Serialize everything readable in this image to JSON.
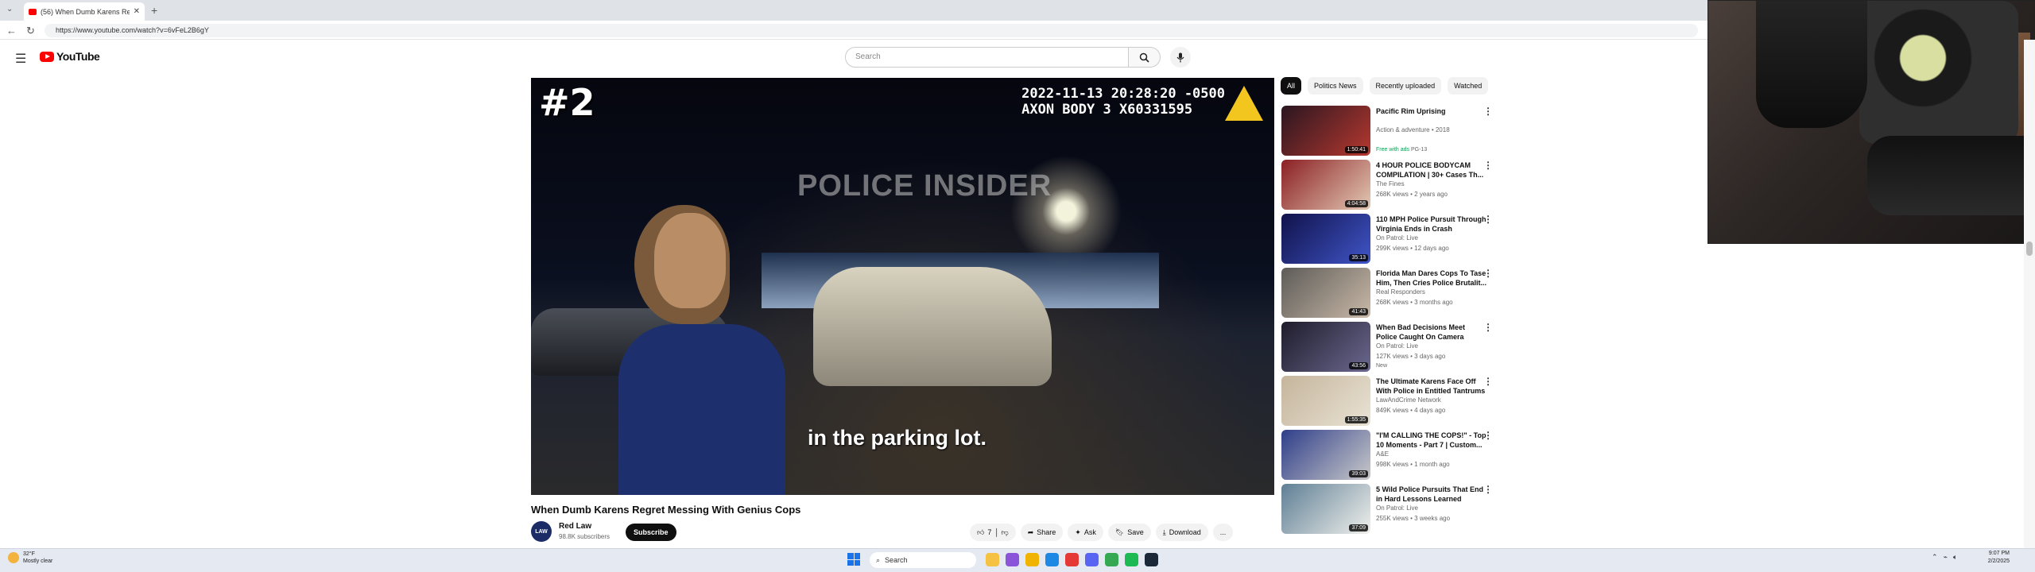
{
  "browser": {
    "tab_title": "(56) When Dumb Karens Re",
    "new_tab": "+",
    "url": "https://www.youtube.com/watch?v=6vFeL2B6gY"
  },
  "youtube": {
    "logo": "YouTube",
    "search_placeholder": "Search"
  },
  "video": {
    "rank_overlay": "#2",
    "timestamp_line1": "2022-11-13 20:28:20 -0500",
    "timestamp_line2": "AXON BODY 3 X60331595",
    "watermark": "POLICE INSIDER",
    "caption": "in the parking lot.",
    "title": "When Dumb Karens Regret Messing With Genius Cops",
    "channel_name": "Red Law",
    "channel_avatar_text": "LAW",
    "channel_subs": "98.8K subscribers",
    "subscribe_label": "Subscribe",
    "like_count": "7",
    "share_label": "Share",
    "ask_label": "Ask",
    "save_label": "Save",
    "download_label": "Download",
    "more_label": "..."
  },
  "chips": [
    "All",
    "Politics News",
    "Recently uploaded",
    "Watched"
  ],
  "recommendations": [
    {
      "title": "Pacific Rim Uprising",
      "channel": "Action & adventure • 2018",
      "meta": "",
      "badge_free": "Free with ads",
      "badge_rating": "PG-13",
      "duration": "1:50:41",
      "colors": [
        "#2a1620",
        "#b6382f"
      ]
    },
    {
      "title": "4 HOUR POLICE BODYCAM COMPILATION | 30+ Cases Th...",
      "channel": "The Fines",
      "meta": "268K views • 2 years ago",
      "badge_free": "",
      "badge_rating": "",
      "duration": "4:04:58",
      "colors": [
        "#8b1f23",
        "#e3c9b4"
      ]
    },
    {
      "title": "110 MPH Police Pursuit Through Virginia Ends in Crash",
      "channel": "On Patrol: Live",
      "meta": "299K views • 12 days ago",
      "badge_free": "",
      "badge_rating": "",
      "duration": "35:13",
      "colors": [
        "#10124a",
        "#4055c8"
      ]
    },
    {
      "title": "Florida Man Dares Cops To Tase Him, Then Cries Police Brutalit...",
      "channel": "Real Responders",
      "meta": "268K views • 3 months ago",
      "badge_free": "",
      "badge_rating": "",
      "duration": "41:43",
      "colors": [
        "#5d5b58",
        "#c9b9a7"
      ]
    },
    {
      "title": "When Bad Decisions Meet Police Caught On Camera",
      "channel": "On Patrol: Live",
      "meta": "127K views • 3 days ago",
      "badge_free": "",
      "badge_rating": "New",
      "duration": "43:56",
      "colors": [
        "#1e1c2a",
        "#6b6890"
      ]
    },
    {
      "title": "The Ultimate Karens Face Off With Police in Entitled Tantrums",
      "channel": "LawAndCrime Network",
      "meta": "849K views • 4 days ago",
      "badge_free": "",
      "badge_rating": "",
      "duration": "1:55:35",
      "colors": [
        "#c5b59c",
        "#e9e2d4"
      ]
    },
    {
      "title": "\"I'M CALLING THE COPS!\" - Top 10 Moments - Part 7 | Custom...",
      "channel": "A&E",
      "meta": "998K views • 1 month ago",
      "badge_free": "",
      "badge_rating": "",
      "duration": "39:03",
      "colors": [
        "#2f3e8a",
        "#c9c9c9"
      ]
    },
    {
      "title": "5 Wild Police Pursuits That End in Hard Lessons Learned",
      "channel": "On Patrol: Live",
      "meta": "255K views • 3 weeks ago",
      "badge_free": "",
      "badge_rating": "",
      "duration": "37:09",
      "colors": [
        "#5f7f95",
        "#f0f0ec"
      ]
    }
  ],
  "taskbar": {
    "weather_temp": "32°F",
    "weather_desc": "Mostly clear",
    "search_label": "Search",
    "time": "9:07 PM",
    "date": "2/2/2025"
  },
  "icons": {
    "tab_favicon": "youtube-icon",
    "menu": "hamburger-icon",
    "search": "search-icon",
    "mic": "mic-icon"
  }
}
